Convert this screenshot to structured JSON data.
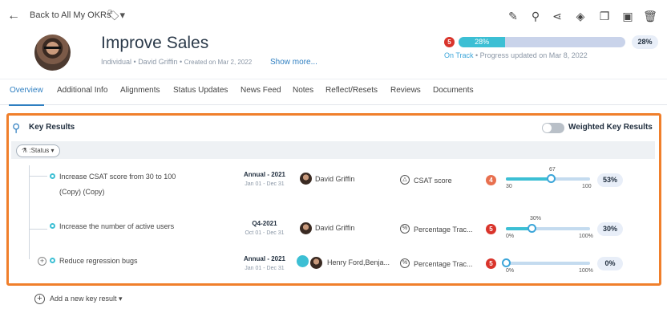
{
  "topbar": {
    "back_label": "Back to All My OKRs",
    "tag_icon": "tag-icon",
    "actions": [
      "pencil-icon",
      "user-add-icon",
      "share-icon",
      "layers-icon",
      "copy-icon",
      "edit-note-icon",
      "trash-icon"
    ]
  },
  "objective": {
    "title": "Improve Sales",
    "type": "Individual",
    "owner": "David Griffin",
    "created": "Created on Mar 2, 2022",
    "show_more": "Show more...",
    "risk_count": "5",
    "progress": 0.28,
    "progress_label": "28%",
    "status": "On Track",
    "updated": "Progress updated on Mar 8, 2022"
  },
  "tabs": [
    "Overview",
    "Additional Info",
    "Alignments",
    "Status Updates",
    "News Feed",
    "Notes",
    "Reflect/Resets",
    "Reviews",
    "Documents"
  ],
  "key_results": {
    "title": "Key Results",
    "weighted_label": "Weighted Key Results",
    "filter_label": ":Status",
    "rows": [
      {
        "name_line1": "Increase CSAT score from 30 to 100",
        "name_line2": "(Copy) (Copy)",
        "period": "Annual - 2021",
        "dates": "Jan 01 - Dec 31",
        "owner": "David Griffin",
        "metric_icon": "triangle-metric-icon",
        "metric": "CSAT score",
        "risk": "4",
        "risk_color": "#e8704f",
        "slider_start": "30",
        "slider_end": "100",
        "slider_value": "67",
        "progress": 0.53,
        "progress_label": "53%"
      },
      {
        "name_line1": "Increase the number of active users",
        "period": "Q4-2021",
        "dates": "Oct 01 - Dec 31",
        "owner": "David Griffin",
        "metric_icon": "percent-metric-icon",
        "metric": "Percentage Trac...",
        "risk": "5",
        "risk_color": "#d9342b",
        "slider_start": "0%",
        "slider_end": "100%",
        "slider_value": "30%",
        "progress": 0.3,
        "progress_label": "30%"
      },
      {
        "name_line1": "Reduce regression bugs",
        "period": "Annual - 2021",
        "dates": "Jan 01 - Dec 31",
        "owner": "Henry Ford,Benja...",
        "metric_icon": "percent-metric-icon",
        "metric": "Percentage Trac...",
        "risk": "5",
        "risk_color": "#d9342b",
        "slider_start": "0%",
        "slider_end": "100%",
        "progress": 0.0,
        "progress_label": "0%"
      }
    ]
  },
  "add_key_result": "Add a new key result"
}
